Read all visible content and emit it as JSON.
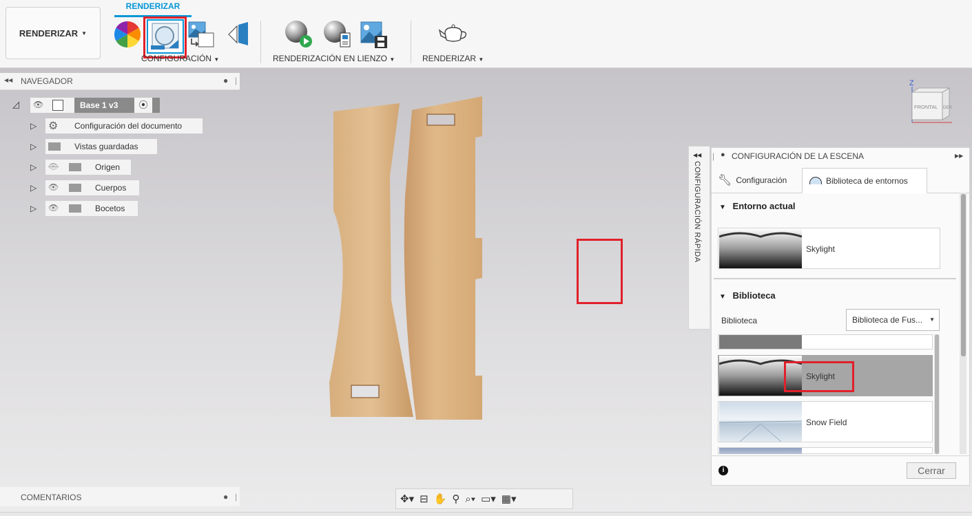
{
  "toolbar": {
    "workspace_label": "RENDERIZAR",
    "workspace_arrow": "▼",
    "active_tab": "RENDERIZAR",
    "groups": [
      {
        "label": "CONFIGURACIÓN",
        "arrow": "▼"
      },
      {
        "label": "RENDERIZACIÓN EN LIENZO",
        "arrow": "▼"
      },
      {
        "label": "RENDERIZAR",
        "arrow": "▼"
      }
    ],
    "tools": [
      "appearance-icon",
      "scene-settings-icon",
      "texture-map-icon",
      "decal-icon",
      "in-canvas-render-icon",
      "in-canvas-render-settings-icon",
      "capture-image-icon",
      "teapot-render-icon"
    ]
  },
  "navigator": {
    "title": "NAVEGADOR",
    "root": "Base 1 v3",
    "items": [
      {
        "label": "Configuración del documento",
        "icon": "gear-icon"
      },
      {
        "label": "Vistas guardadas",
        "icon": "folder-icon"
      },
      {
        "label": "Origen",
        "icon": "folder-icon"
      },
      {
        "label": "Cuerpos",
        "icon": "folder-icon"
      },
      {
        "label": "Bocetos",
        "icon": "folder-icon"
      }
    ]
  },
  "comments": {
    "title": "COMENTARIOS"
  },
  "viewcube": {
    "axis": "Z",
    "front": "FRONTAL",
    "side": "DER"
  },
  "quick_settings": {
    "label": "CONFIGURACIÓN RÁPIDA"
  },
  "scene_panel": {
    "title": "CONFIGURACIÓN DE LA ESCENA",
    "tabs": [
      {
        "label": "Configuración",
        "icon": "wrench-icon"
      },
      {
        "label": "Biblioteca de entornos",
        "icon": "environment-dome-icon"
      }
    ],
    "current_section": "Entorno actual",
    "current_env": "Skylight",
    "library_section": "Biblioteca",
    "library_label": "Biblioteca",
    "library_select": "Biblioteca de Fus...",
    "library_items": [
      {
        "name": "",
        "selected": false
      },
      {
        "name": "Skylight",
        "selected": true
      },
      {
        "name": "Snow Field",
        "selected": false
      },
      {
        "name": "",
        "selected": false
      }
    ],
    "close_label": "Cerrar",
    "colors": {
      "selected_bg": "#a6a6a6",
      "accent": "#0696d7",
      "highlight": "#e0202a"
    }
  }
}
